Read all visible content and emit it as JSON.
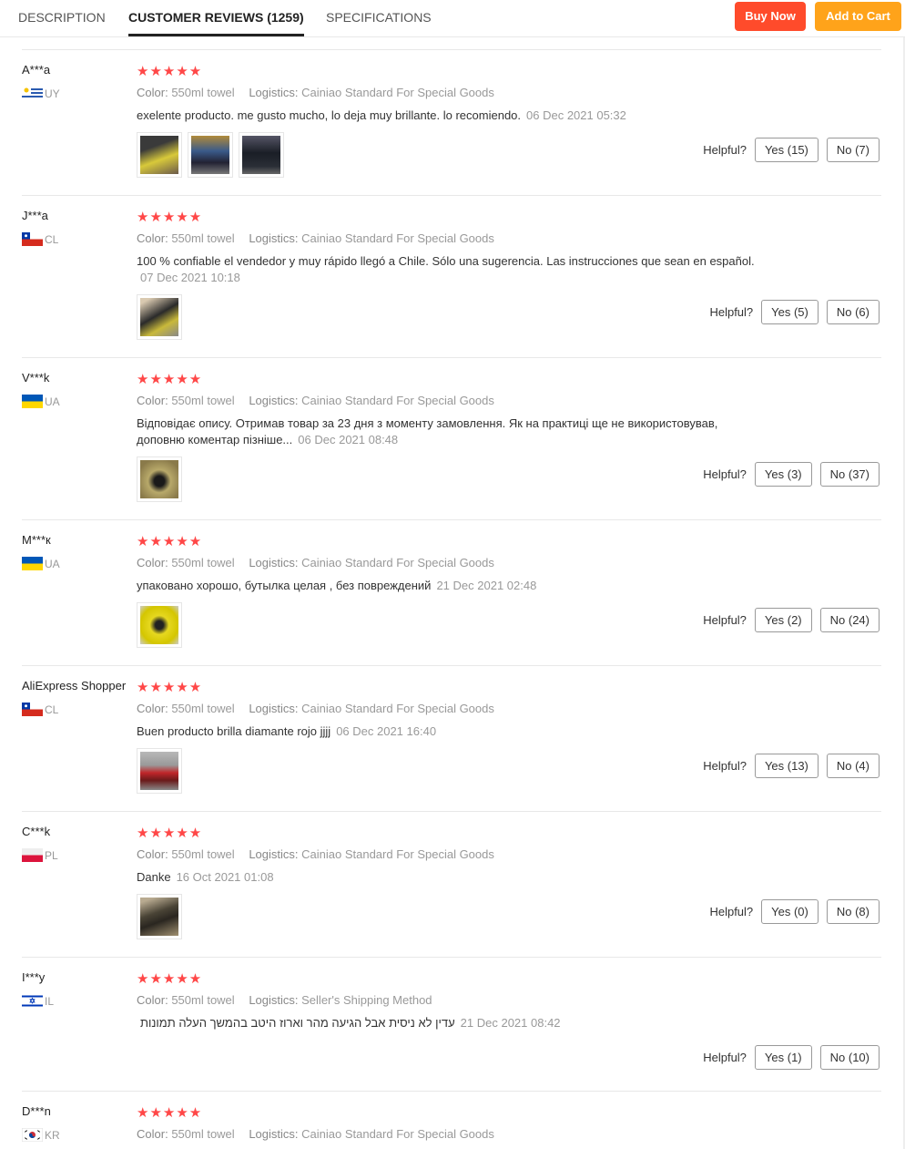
{
  "tabs": [
    {
      "label": "DESCRIPTION"
    },
    {
      "label": "CUSTOMER REVIEWS (1259)"
    },
    {
      "label": "SPECIFICATIONS"
    }
  ],
  "actions": {
    "buy_now": "Buy Now",
    "add_to_cart": "Add to Cart"
  },
  "labels": {
    "color": "Color:",
    "logistics": "Logistics:",
    "helpful": "Helpful?",
    "stars": "★★★★★"
  },
  "reviews": [
    {
      "user": "A***a",
      "country": "UY",
      "color": "550ml towel",
      "logistics": "Cainiao Standard For Special Goods",
      "text": "exelente producto. me gusto mucho, lo deja muy brillante. lo recomiendo.",
      "date": "06 Dec 2021 05:32",
      "yes": "Yes (15)",
      "no": "No (7)"
    },
    {
      "user": "J***a",
      "country": "CL",
      "color": "550ml towel",
      "logistics": "Cainiao Standard For Special Goods",
      "text": "100 % confiable el vendedor y muy rápido llegó a Chile. Sólo una sugerencia. Las instrucciones que sean en español.",
      "date": "07 Dec 2021 10:18",
      "yes": "Yes (5)",
      "no": "No (6)"
    },
    {
      "user": "V***k",
      "country": "UA",
      "color": "550ml towel",
      "logistics": "Cainiao Standard For Special Goods",
      "text": "Відповідає опису. Отримав товар за 23 дня з моменту замовлення. Як на практиці ще не використовував, доповню коментар пізніше...",
      "date": "06 Dec 2021 08:48",
      "yes": "Yes (3)",
      "no": "No (37)"
    },
    {
      "user": "M***к",
      "country": "UA",
      "color": "550ml towel",
      "logistics": "Cainiao Standard For Special Goods",
      "text": "упаковано хорошо, бутылка целая , без повреждений",
      "date": "21 Dec 2021 02:48",
      "yes": "Yes (2)",
      "no": "No (24)"
    },
    {
      "user": "AliExpress Shopper",
      "country": "CL",
      "color": "550ml towel",
      "logistics": "Cainiao Standard For Special Goods",
      "text": "Buen producto brilla diamante rojo jjjj",
      "date": "06 Dec 2021 16:40",
      "yes": "Yes (13)",
      "no": "No (4)"
    },
    {
      "user": "C***k",
      "country": "PL",
      "color": "550ml towel",
      "logistics": "Cainiao Standard For Special Goods",
      "text": "Danke",
      "date": "16 Oct 2021 01:08",
      "yes": "Yes (0)",
      "no": "No (8)"
    },
    {
      "user": "I***y",
      "country": "IL",
      "color": "550ml towel",
      "logistics": "Seller's Shipping Method",
      "text": "עדין לא ניסית אבל הגיעה מהר וארוז היטב בהמשך העלה תמונות",
      "date": "21 Dec 2021 08:42",
      "yes": "Yes (1)",
      "no": "No (10)"
    },
    {
      "user": "D***n",
      "country": "KR",
      "color": "550ml towel",
      "logistics": "Cainiao Standard For Special Goods"
    }
  ]
}
